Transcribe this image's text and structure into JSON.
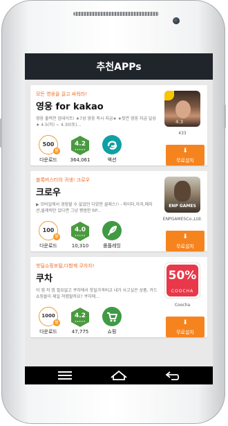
{
  "header": {
    "title": "추천APPs"
  },
  "apps": [
    {
      "promo": "모든 영웅을 걸고 싸워라!",
      "name": "영웅 for kakao",
      "description": "영웅 출력전 업데이트! ★7성 영웅 즉시 지급★ ★첫연 영웅 지급 달성★ 4.5(하) ~ 4.30(토)...",
      "downloads": "500",
      "downloads_badge": "만",
      "rating": "4.2",
      "rating_count": "364,061",
      "category": "액션",
      "category_icon": "action-icon",
      "developer": "433",
      "download_label": "다운로드",
      "install_label": "무료설치"
    },
    {
      "promo": "블록버스터의 귀생! 크로우",
      "name": "크로우",
      "description": "▶ 모바일에서 경험할 수 없었던 다양한 클래스!! - 파이터,아처,메지션,클레릭만 있다면 그냥 평범한 RP...",
      "downloads": "100",
      "downloads_badge": "만",
      "rating": "4.0",
      "rating_count": "10,310",
      "category": "롤플레잉",
      "category_icon": "feather-icon",
      "developer": "ENPGAMESCo.,Ltd.",
      "icon_text": "ENP GAMES",
      "download_label": "다운로드",
      "install_label": "무료설치"
    },
    {
      "promo": "핫딜쇼핑포털,다함께 쿠차차!",
      "name": "쿠차",
      "description": "이 앱 저 앱 필요없고 쿠차에서 핫딜가격비교 내가 사고싶은 상품, 카드 쇼핑몰이 제일 저렴할까요? 쿠차에...",
      "downloads": "1000",
      "downloads_badge": "만",
      "rating": "4.2",
      "rating_count": "47,775",
      "category": "쇼핑",
      "category_icon": "cart-icon",
      "developer": "Coocha",
      "icon_text": "50%",
      "icon_subtext": "COOCHA",
      "download_label": "다운로드",
      "install_label": "무료설치"
    }
  ],
  "colors": {
    "accent": "#f5841f",
    "rating_green": "#4a9a3f",
    "appbar": "#1f252b"
  },
  "nav_icons": [
    "menu-icon",
    "home-icon",
    "back-icon"
  ]
}
